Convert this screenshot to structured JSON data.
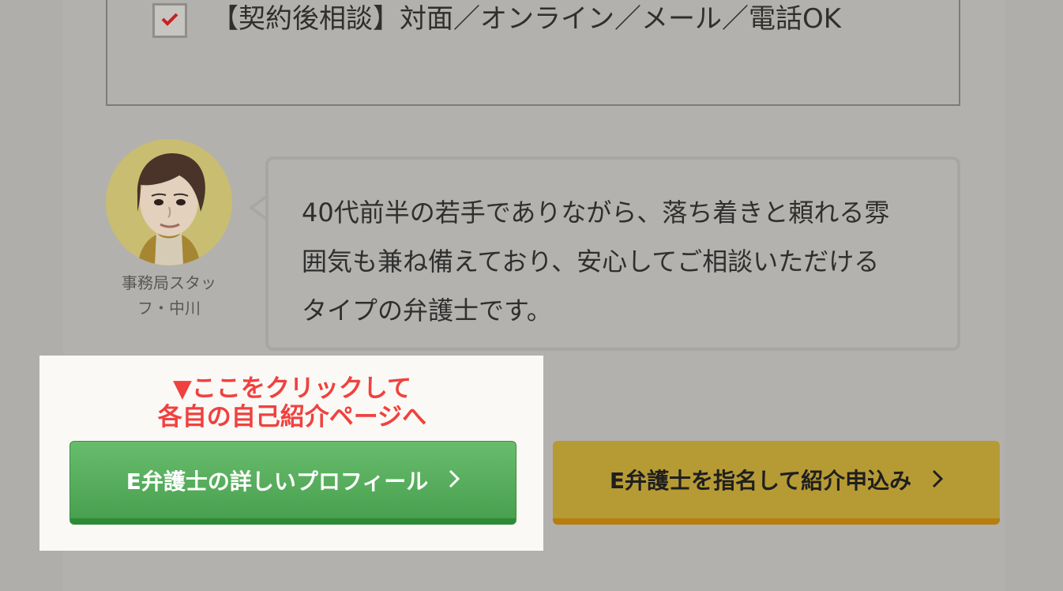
{
  "checklist": {
    "item": "【契約後相談】対面／オンライン／メール／電話OK"
  },
  "staff": {
    "name_line1": "事務局スタッ",
    "name_line2": "フ・中川"
  },
  "bubble": {
    "line1": "40代前半の若手でありながら、落ち着きと頼れる雰",
    "line2": "囲気も兼ね備えており、安心してご相談いただける",
    "line3": "タイプの弁護士です。"
  },
  "callout": {
    "line1": "▼ここをクリックして",
    "line2": "各自の自己紹介ページへ"
  },
  "buttons": {
    "profile": "E弁護士の詳しいプロフィール",
    "request": "E弁護士を指名して紹介申込み"
  },
  "colors": {
    "check": "#c92020",
    "callout": "#f0413f",
    "green_button": "#49a04f",
    "gold_button": "#b69b35"
  },
  "icons": {
    "check": "check-icon",
    "arrow": "chevron-right-icon"
  }
}
